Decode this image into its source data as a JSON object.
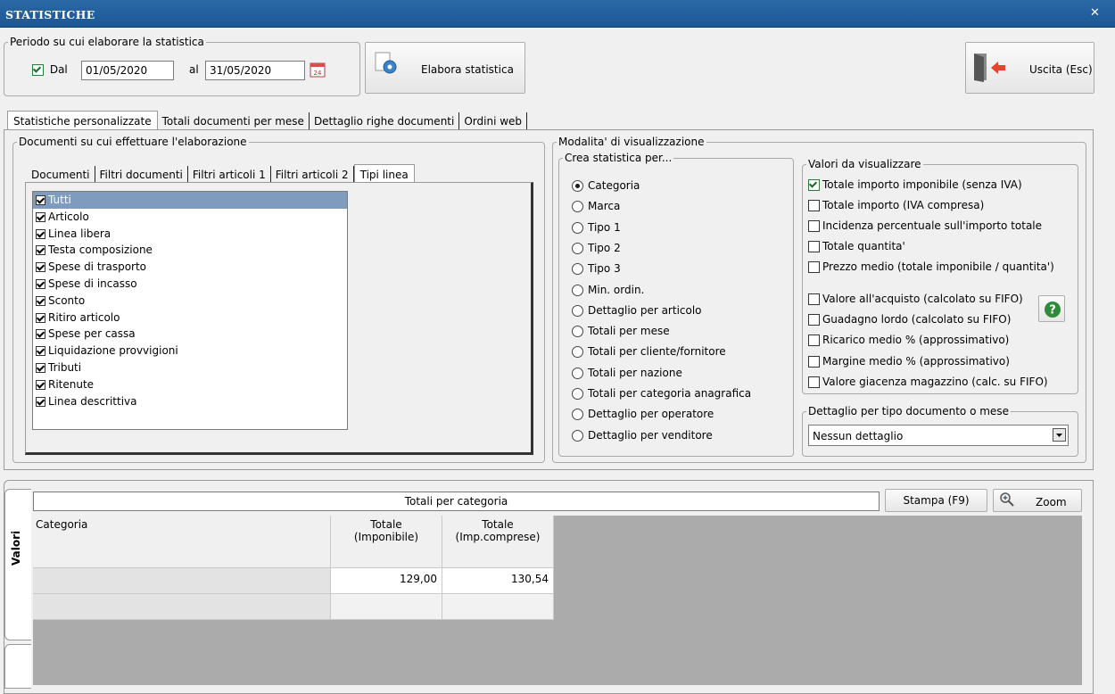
{
  "window": {
    "title": "STATISTICHE"
  },
  "period": {
    "legend": "Periodo su cui elaborare la statistica",
    "dal_label": "Dal",
    "dal_checked": true,
    "date_from": "01/05/2020",
    "al_label": "al",
    "date_to": "31/05/2020",
    "calendar_day": "24"
  },
  "toolbar": {
    "elabora_label": "Elabora statistica",
    "exit_label": "Uscita (Esc)"
  },
  "main_tabs": [
    "Statistiche personalizzate",
    "Totali documenti per mese",
    "Dettaglio righe documenti",
    "Ordini web"
  ],
  "documents_section": {
    "legend": "Documenti su cui effettuare l'elaborazione",
    "tabs": [
      "Documenti",
      "Filtri documenti",
      "Filtri articoli 1",
      "Filtri articoli 2",
      "Tipi linea"
    ],
    "line_types": [
      {
        "label": "Tutti",
        "checked": true,
        "selected": true
      },
      {
        "label": "Articolo",
        "checked": true
      },
      {
        "label": "Linea libera",
        "checked": true
      },
      {
        "label": "Testa composizione",
        "checked": true
      },
      {
        "label": "Spese di trasporto",
        "checked": true
      },
      {
        "label": "Spese di incasso",
        "checked": true
      },
      {
        "label": "Sconto",
        "checked": true
      },
      {
        "label": "Ritiro articolo",
        "checked": true
      },
      {
        "label": "Spese per cassa",
        "checked": true
      },
      {
        "label": "Liquidazione provvigioni",
        "checked": true
      },
      {
        "label": "Tributi",
        "checked": true
      },
      {
        "label": "Ritenute",
        "checked": true
      },
      {
        "label": "Linea descrittiva",
        "checked": true
      }
    ]
  },
  "visualization": {
    "legend": "Modalita' di visualizzazione",
    "create_legend": "Crea statistica per...",
    "create_options": [
      "Categoria",
      "Marca",
      "Tipo 1",
      "Tipo 2",
      "Tipo 3",
      "Min. ordin.",
      "Dettaglio per articolo",
      "Totali per mese",
      "Totali per cliente/fornitore",
      "Totali per nazione",
      "Totali per categoria anagrafica",
      "Dettaglio per operatore",
      "Dettaglio per venditore"
    ],
    "selected_option": 0,
    "values_legend": "Valori da visualizzare",
    "values_group1": [
      {
        "label": "Totale importo imponibile (senza IVA)",
        "checked": true
      },
      {
        "label": "Totale importo (IVA compresa)",
        "checked": false
      },
      {
        "label": "Incidenza percentuale sull'importo totale",
        "checked": false
      },
      {
        "label": "Totale quantita'",
        "checked": false
      },
      {
        "label": "Prezzo medio (totale imponibile / quantita')",
        "checked": false
      }
    ],
    "values_group2": [
      {
        "label": "Valore all'acquisto (calcolato su FIFO)",
        "checked": false
      },
      {
        "label": "Guadagno lordo (calcolato su FIFO)",
        "checked": false
      },
      {
        "label": "Ricarico medio % (approssimativo)",
        "checked": false
      },
      {
        "label": "Margine medio % (approssimativo)",
        "checked": false
      },
      {
        "label": "Valore giacenza magazzino (calc. su FIFO)",
        "checked": false
      }
    ],
    "detail_legend": "Dettaglio per tipo documento o mese",
    "detail_value": "Nessun dettaglio"
  },
  "results": {
    "side_tab": "Valori",
    "title": "Totali per categoria",
    "print_label": "Stampa (F9)",
    "zoom_label": "Zoom",
    "columns": [
      "Categoria",
      "Totale\n(Imponibile)",
      "Totale\n(Imp.comprese)"
    ],
    "rows": [
      {
        "categoria": "",
        "imponibile": "129,00",
        "comprese": "130,54"
      },
      {
        "categoria": "",
        "imponibile": "",
        "comprese": ""
      }
    ]
  },
  "colors": {
    "titlebar": "#1c5796",
    "selection": "#7f9bbd",
    "grid_bg": "#ababab",
    "help_green": "#2e8b3a"
  }
}
